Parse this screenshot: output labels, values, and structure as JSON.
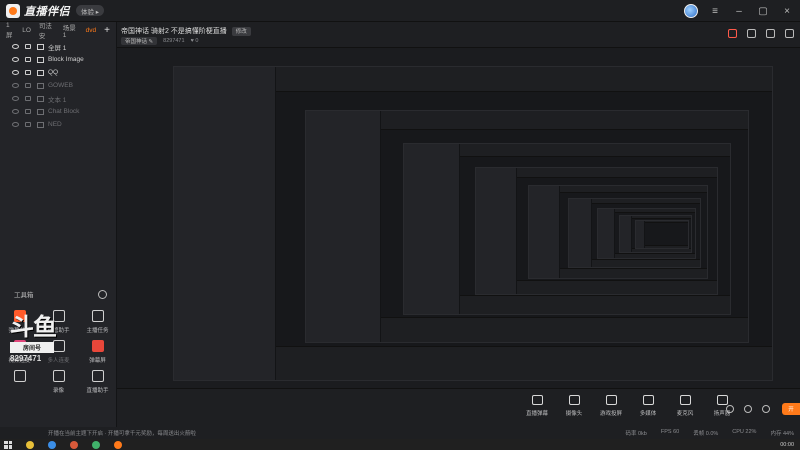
{
  "app": {
    "name": "直播伴侣",
    "version_badge": "体验 ▸",
    "window_controls": [
      "–",
      "▢",
      "×"
    ]
  },
  "scenes": {
    "tabs": [
      "1屏",
      "LO",
      "司法安",
      "场景 1",
      "dvd"
    ],
    "active_index": 4,
    "add_label": "+"
  },
  "sources": [
    {
      "label": "全屏 1",
      "enabled": true
    },
    {
      "label": "Block Image",
      "enabled": true
    },
    {
      "label": "QQ",
      "enabled": true
    },
    {
      "label": "GOWEB",
      "enabled": false
    },
    {
      "label": "文本 1",
      "enabled": false
    },
    {
      "label": "Chat Block",
      "enabled": false
    },
    {
      "label": "NED",
      "enabled": false
    }
  ],
  "toolbox": {
    "title": "工具箱",
    "tools": [
      {
        "label": "弹幕助手",
        "icon": "danmu-icon",
        "tone": "orange",
        "enabled": true
      },
      {
        "label": "房管助手",
        "icon": "admin-icon",
        "tone": "plain",
        "enabled": true
      },
      {
        "label": "主播任务",
        "icon": "task-icon",
        "tone": "plain",
        "enabled": true
      },
      {
        "label": "视频连麦",
        "icon": "video-link-icon",
        "tone": "pink",
        "enabled": true
      },
      {
        "label": "多人连麦",
        "icon": "multi-link-icon",
        "tone": "plain",
        "enabled": false
      },
      {
        "label": "弹幕屏",
        "icon": "danmu-screen-icon",
        "tone": "red",
        "enabled": true
      },
      {
        "label": "",
        "icon": "gift-icon",
        "tone": "plain",
        "enabled": true
      },
      {
        "label": "录像",
        "icon": "record-icon",
        "tone": "plain",
        "enabled": true
      },
      {
        "label": "直播助手",
        "icon": "assistant-icon",
        "tone": "plain",
        "enabled": true
      }
    ]
  },
  "room": {
    "title": "帝国神话 骑射2 不是搞懂阶梗直播",
    "edit_label": "修改",
    "category": "帝国神话 ✎",
    "room_id": "8297471",
    "viewers": "♥ 0"
  },
  "watermark": {
    "brand": "斗鱼",
    "room_label": "房间号",
    "room_number": "8297471"
  },
  "controls": [
    {
      "label": "直播弹幕",
      "icon": "danmu-icon"
    },
    {
      "label": "摄像头",
      "icon": "camera-icon"
    },
    {
      "label": "游戏投屏",
      "icon": "cast-icon"
    },
    {
      "label": "多媒体",
      "icon": "media-icon"
    },
    {
      "label": "麦克风",
      "icon": "mic-icon"
    },
    {
      "label": "扬声器",
      "icon": "speaker-icon"
    }
  ],
  "go_live_label": "开",
  "status": {
    "left": "开播在当前主题下开启 · 开播可拿千元奖励，每周送出火箭啦",
    "right": [
      "码率 0kb",
      "FPS 60",
      "丢帧 0.0%",
      "CPU 22%",
      "内存 44%"
    ]
  },
  "taskbar": {
    "clock": "00:00"
  }
}
